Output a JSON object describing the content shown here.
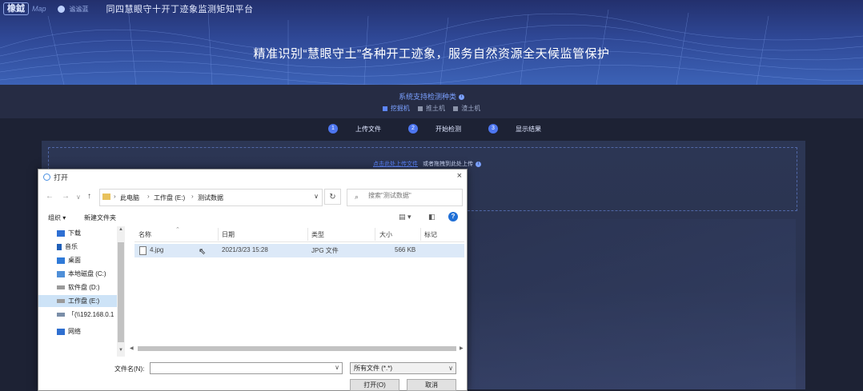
{
  "header": {
    "logo": "橡鉞",
    "logo_sub": "Map",
    "logo_small": "谧谧蓝",
    "platform_title": "同四慧眼守十开丁迹象监测矩知平台",
    "slogan": "精准识别“慧眼守土”各种开工迹象，服务自然资源全天候监管保护"
  },
  "support": {
    "title": "系统支持检测种类",
    "options": [
      {
        "label": "挖掘机",
        "active": true
      },
      {
        "label": "推土机",
        "active": false
      },
      {
        "label": "渣土机",
        "active": false
      }
    ]
  },
  "steps": [
    {
      "num": "1",
      "label": "上传文件"
    },
    {
      "num": "2",
      "label": "开始检测"
    },
    {
      "num": "3",
      "label": "显示结果"
    }
  ],
  "dropzone": {
    "link": "点击此处上传文件",
    "text": "或者拖拽到此处上传"
  },
  "dialog": {
    "title": "打开",
    "close": "×",
    "breadcrumb": [
      "此电脑",
      "工作盘 (E:)",
      "测试数据"
    ],
    "search_placeholder": "搜索\"测试数据\"",
    "toolbar": {
      "organize": "组织 ▾",
      "new_folder": "新建文件夹"
    },
    "nav_items": [
      {
        "label": "下载",
        "icon": "download-icon",
        "selected": false
      },
      {
        "label": "音乐",
        "icon": "music-icon",
        "selected": false
      },
      {
        "label": "桌面",
        "icon": "desktop-icon",
        "selected": false
      },
      {
        "label": "本地磁盘 (C:)",
        "icon": "drive-icon",
        "selected": false
      },
      {
        "label": "软件盘 (D:)",
        "icon": "drive-icon",
        "selected": false
      },
      {
        "label": "工作盘 (E:)",
        "icon": "drive-icon",
        "selected": true
      },
      {
        "label": "「(\\\\192.168.0.1",
        "icon": "network-drive-icon",
        "selected": false
      },
      {
        "label": "网络",
        "icon": "network-icon",
        "selected": false
      }
    ],
    "columns": [
      "名称",
      "日期",
      "类型",
      "大小",
      "标记"
    ],
    "files": [
      {
        "name": "4.jpg",
        "date": "2021/3/23 15:28",
        "type": "JPG 文件",
        "size": "566 KB"
      }
    ],
    "filename_label": "文件名(N):",
    "filename_value": "",
    "filetype": "所有文件 (*.*)",
    "open_button": "打开(O)",
    "cancel_button": "取消"
  }
}
